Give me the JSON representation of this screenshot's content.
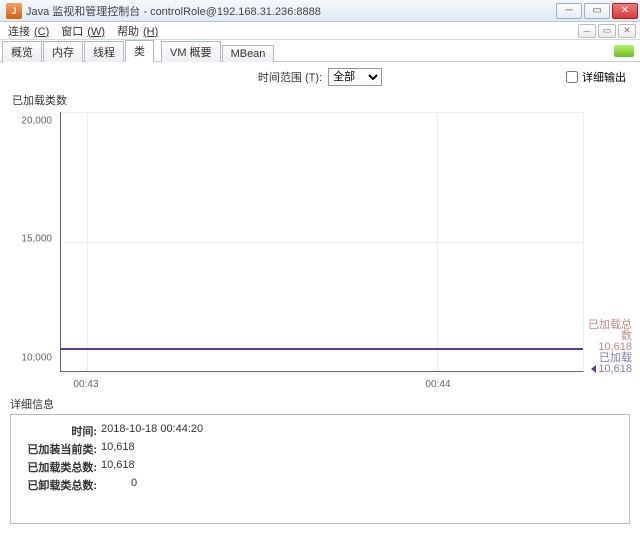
{
  "window": {
    "title": "Java 监视和管理控制台 - controlRole@192.168.31.236:8888",
    "icon_text": "J"
  },
  "menu": {
    "connect": "连接",
    "connect_key": "(C)",
    "window": "窗口",
    "window_key": "(W)",
    "help": "帮助",
    "help_key": "(H)"
  },
  "tabs": {
    "overview": "概览",
    "memory": "内存",
    "threads": "线程",
    "classes": "类",
    "vm_summary": "VM 概要",
    "mbeans": "MBean"
  },
  "toolbar": {
    "time_range_label": "时间范围 (T):",
    "time_range_value": "全部",
    "detail_output": "详细输出"
  },
  "chart_title": "已加载类数",
  "chart_data": {
    "type": "line",
    "series": [
      {
        "name": "已加载总数",
        "value_label": "10,618",
        "color": "#c08888"
      },
      {
        "name": "已加载",
        "value_label": "10,618",
        "color": "#5a3a9a"
      }
    ],
    "y_ticks": [
      "10,000",
      "15,000",
      "20,000"
    ],
    "ylim": [
      10000,
      20000
    ],
    "x_ticks": [
      "00:43",
      "00:44"
    ],
    "current_value": 10618
  },
  "details": {
    "title": "详细信息",
    "rows": {
      "time_k": "时间:",
      "time_v": "2018-10-18 00:44:20",
      "loaded_current_k": "已加装当前类:",
      "loaded_current_v": "10,618",
      "loaded_total_k": "已加载类总数:",
      "loaded_total_v": "10,618",
      "unloaded_total_k": "已卸载类总数:",
      "unloaded_total_v": "0"
    }
  }
}
